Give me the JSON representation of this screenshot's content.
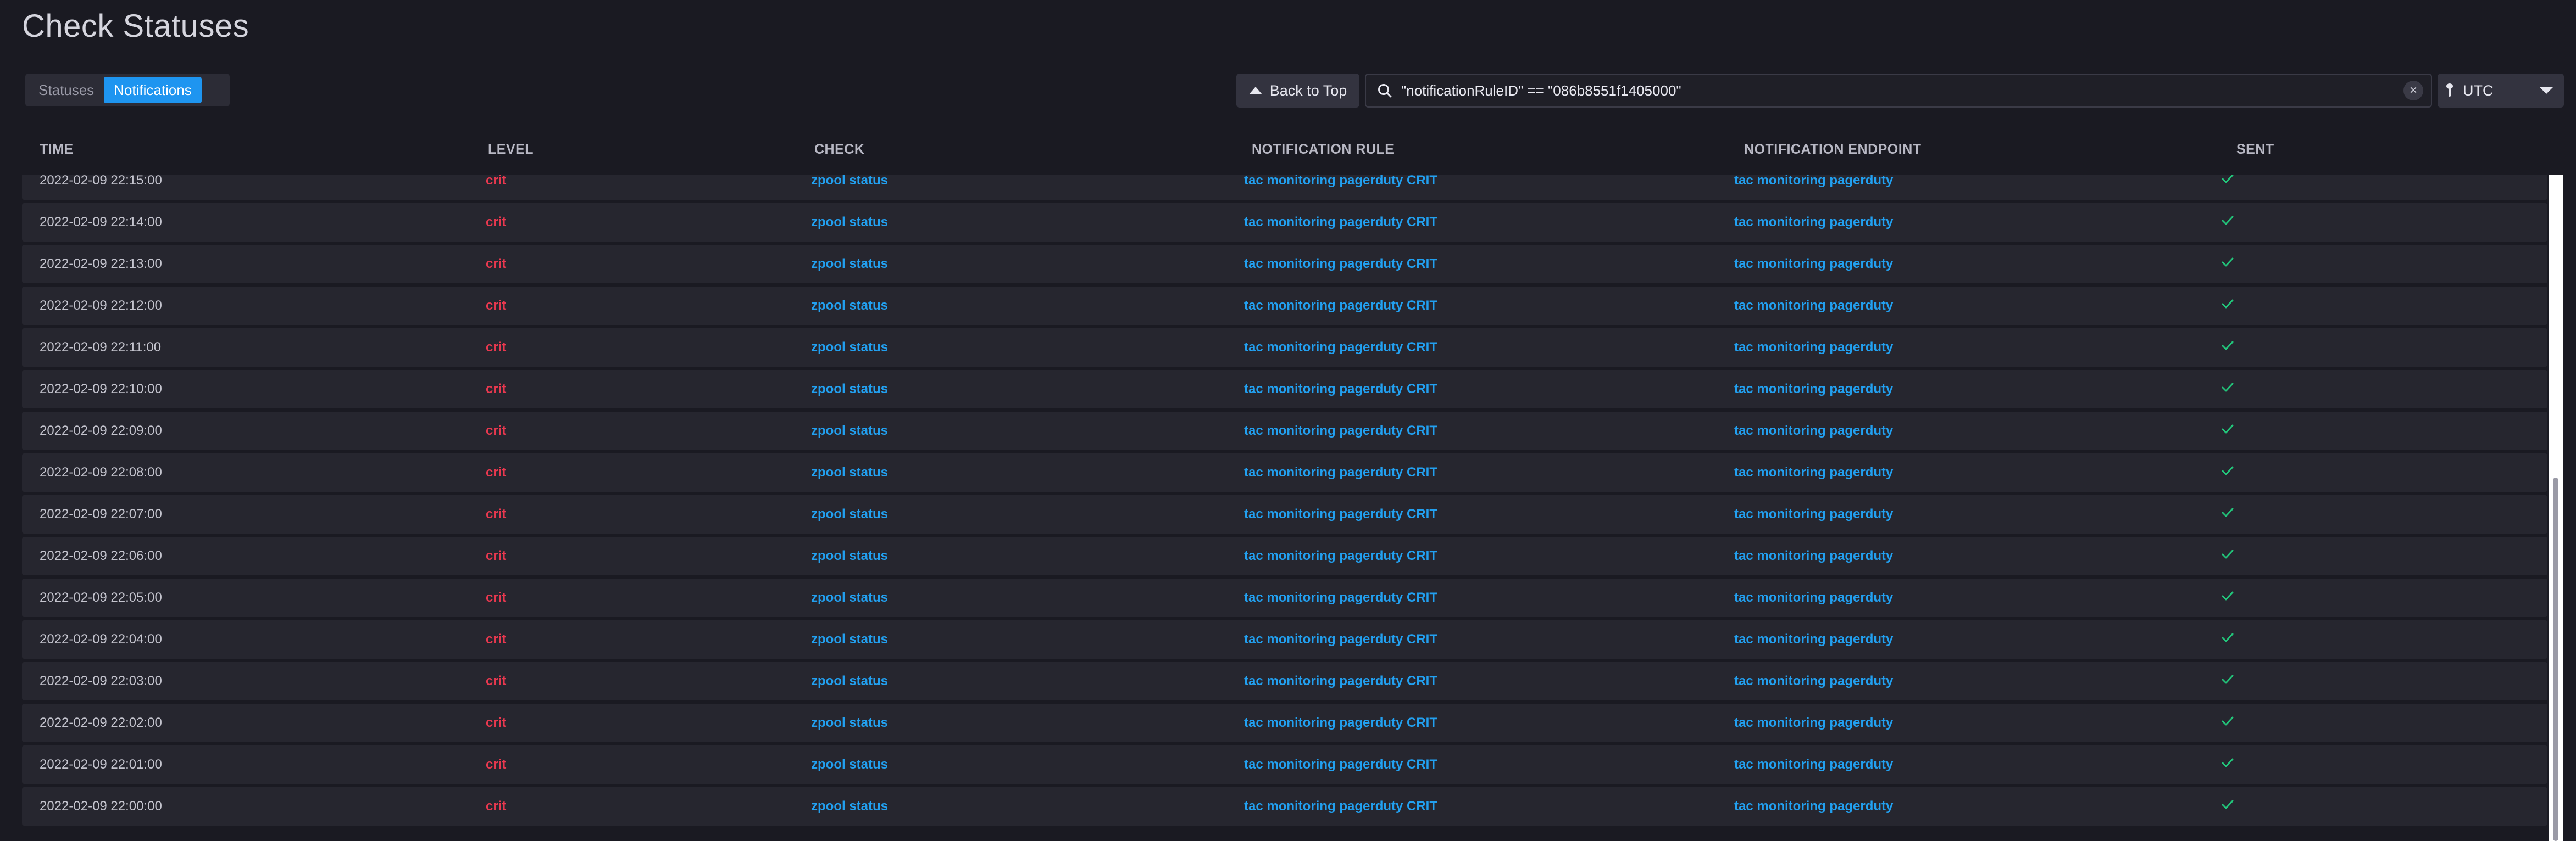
{
  "page": {
    "title": "Check Statuses"
  },
  "tabs": [
    {
      "label": "Statuses",
      "active": false
    },
    {
      "label": "Notifications",
      "active": true
    }
  ],
  "toolbar": {
    "back_to_top_label": "Back to Top",
    "search_value": "\"notificationRuleID\" == \"086b8551f1405000\"",
    "timezone": "UTC"
  },
  "table": {
    "columns": [
      "TIME",
      "LEVEL",
      "CHECK",
      "NOTIFICATION RULE",
      "NOTIFICATION ENDPOINT",
      "SENT"
    ],
    "rows": [
      {
        "time": "2022-02-09 22:15:00",
        "level": "crit",
        "check": "zpool status",
        "rule": "tac monitoring pagerduty CRIT",
        "endpoint": "tac monitoring pagerduty",
        "sent": true
      },
      {
        "time": "2022-02-09 22:14:00",
        "level": "crit",
        "check": "zpool status",
        "rule": "tac monitoring pagerduty CRIT",
        "endpoint": "tac monitoring pagerduty",
        "sent": true
      },
      {
        "time": "2022-02-09 22:13:00",
        "level": "crit",
        "check": "zpool status",
        "rule": "tac monitoring pagerduty CRIT",
        "endpoint": "tac monitoring pagerduty",
        "sent": true
      },
      {
        "time": "2022-02-09 22:12:00",
        "level": "crit",
        "check": "zpool status",
        "rule": "tac monitoring pagerduty CRIT",
        "endpoint": "tac monitoring pagerduty",
        "sent": true
      },
      {
        "time": "2022-02-09 22:11:00",
        "level": "crit",
        "check": "zpool status",
        "rule": "tac monitoring pagerduty CRIT",
        "endpoint": "tac monitoring pagerduty",
        "sent": true
      },
      {
        "time": "2022-02-09 22:10:00",
        "level": "crit",
        "check": "zpool status",
        "rule": "tac monitoring pagerduty CRIT",
        "endpoint": "tac monitoring pagerduty",
        "sent": true
      },
      {
        "time": "2022-02-09 22:09:00",
        "level": "crit",
        "check": "zpool status",
        "rule": "tac monitoring pagerduty CRIT",
        "endpoint": "tac monitoring pagerduty",
        "sent": true
      },
      {
        "time": "2022-02-09 22:08:00",
        "level": "crit",
        "check": "zpool status",
        "rule": "tac monitoring pagerduty CRIT",
        "endpoint": "tac monitoring pagerduty",
        "sent": true
      },
      {
        "time": "2022-02-09 22:07:00",
        "level": "crit",
        "check": "zpool status",
        "rule": "tac monitoring pagerduty CRIT",
        "endpoint": "tac monitoring pagerduty",
        "sent": true
      },
      {
        "time": "2022-02-09 22:06:00",
        "level": "crit",
        "check": "zpool status",
        "rule": "tac monitoring pagerduty CRIT",
        "endpoint": "tac monitoring pagerduty",
        "sent": true
      },
      {
        "time": "2022-02-09 22:05:00",
        "level": "crit",
        "check": "zpool status",
        "rule": "tac monitoring pagerduty CRIT",
        "endpoint": "tac monitoring pagerduty",
        "sent": true
      },
      {
        "time": "2022-02-09 22:04:00",
        "level": "crit",
        "check": "zpool status",
        "rule": "tac monitoring pagerduty CRIT",
        "endpoint": "tac monitoring pagerduty",
        "sent": true
      },
      {
        "time": "2022-02-09 22:03:00",
        "level": "crit",
        "check": "zpool status",
        "rule": "tac monitoring pagerduty CRIT",
        "endpoint": "tac monitoring pagerduty",
        "sent": true
      },
      {
        "time": "2022-02-09 22:02:00",
        "level": "crit",
        "check": "zpool status",
        "rule": "tac monitoring pagerduty CRIT",
        "endpoint": "tac monitoring pagerduty",
        "sent": true
      },
      {
        "time": "2022-02-09 22:01:00",
        "level": "crit",
        "check": "zpool status",
        "rule": "tac monitoring pagerduty CRIT",
        "endpoint": "tac monitoring pagerduty",
        "sent": true
      },
      {
        "time": "2022-02-09 22:00:00",
        "level": "crit",
        "check": "zpool status",
        "rule": "tac monitoring pagerduty CRIT",
        "endpoint": "tac monitoring pagerduty",
        "sent": true
      }
    ]
  },
  "icons": {
    "back_to_top": "triangle-up-icon",
    "search": "search-icon",
    "clear": "close-icon",
    "timezone": "pin-icon",
    "dropdown": "caret-down-icon",
    "sent": "check-icon"
  },
  "colors": {
    "background": "#1a1a22",
    "row": "#26262f",
    "accent": "#1e95f0",
    "link": "#22a0f0",
    "crit": "#e8384f",
    "sent_check": "#22c47a"
  }
}
